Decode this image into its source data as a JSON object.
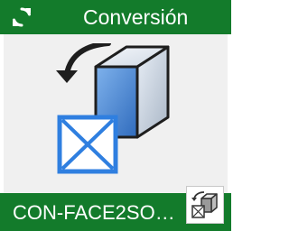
{
  "header": {
    "title": "Conversión",
    "icon": "refresh-icon"
  },
  "main": {
    "icon": "face-to-solid-icon"
  },
  "footer": {
    "command": "CON-FACE2SO…",
    "badge_icon": "face-to-solid-small-icon"
  },
  "colors": {
    "brand_green": "#137b2b",
    "content_bg": "#f0f0f0",
    "cube_blue": "#3d75c6",
    "face_blue": "#2f7fe0"
  }
}
